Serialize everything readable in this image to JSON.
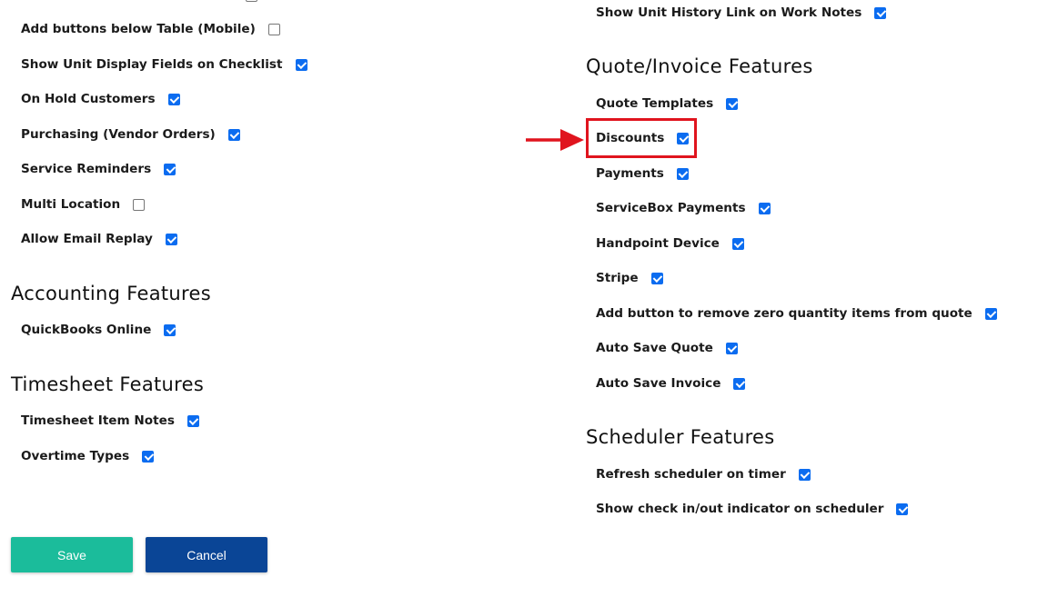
{
  "left_general_items": [
    {
      "label": "Add buttons below Table (Mobile)",
      "checked": false
    },
    {
      "label": "Show Unit Display Fields on Checklist",
      "checked": true
    },
    {
      "label": "On Hold Customers",
      "checked": true
    },
    {
      "label": "Purchasing (Vendor Orders)",
      "checked": true
    },
    {
      "label": "Service Reminders",
      "checked": true
    },
    {
      "label": "Multi Location",
      "checked": false
    },
    {
      "label": "Allow Email Replay",
      "checked": true
    }
  ],
  "accounting": {
    "title": "Accounting Features",
    "items": [
      {
        "label": "QuickBooks Online",
        "checked": true
      }
    ]
  },
  "timesheet": {
    "title": "Timesheet Features",
    "items": [
      {
        "label": "Timesheet Item Notes",
        "checked": true
      },
      {
        "label": "Overtime Types",
        "checked": true
      }
    ]
  },
  "right_top_item": {
    "label": "Show Unit History Link on Work Notes",
    "checked": true
  },
  "quote_invoice": {
    "title": "Quote/Invoice Features",
    "items": [
      {
        "label": "Quote Templates",
        "checked": true
      },
      {
        "label": "Discounts",
        "checked": true
      },
      {
        "label": "Payments",
        "checked": true
      },
      {
        "label": "ServiceBox Payments",
        "checked": true
      },
      {
        "label": "Handpoint Device",
        "checked": true
      },
      {
        "label": "Stripe",
        "checked": true
      },
      {
        "label": "Add button to remove zero quantity items from quote",
        "checked": true
      },
      {
        "label": "Auto Save Quote",
        "checked": true
      },
      {
        "label": "Auto Save Invoice",
        "checked": true
      }
    ]
  },
  "scheduler": {
    "title": "Scheduler Features",
    "items": [
      {
        "label": "Refresh scheduler on timer",
        "checked": true
      },
      {
        "label": "Show check in/out indicator on scheduler",
        "checked": true
      }
    ]
  },
  "buttons": {
    "save_label": "Save",
    "cancel_label": "Cancel"
  },
  "annotation": {
    "highlighted_item": "Discounts",
    "color": "#e0141e"
  },
  "colors": {
    "checkbox_on": "#0b6cf0",
    "save_button": "#1bbc9b",
    "cancel_button": "#0a4596"
  }
}
